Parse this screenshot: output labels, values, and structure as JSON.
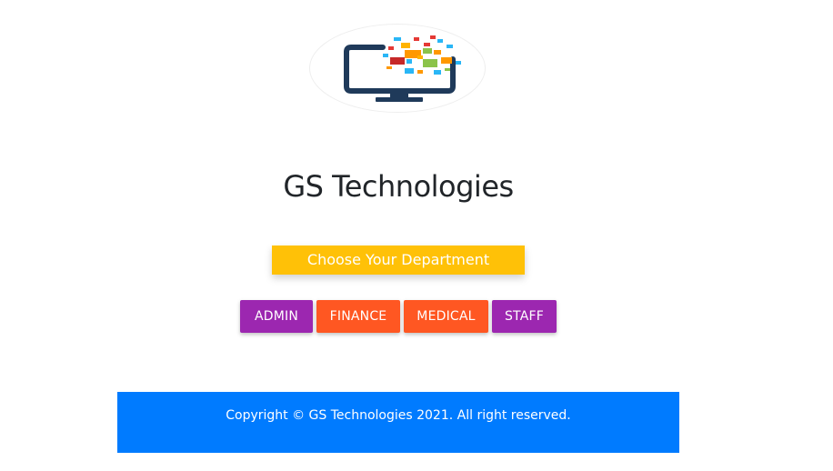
{
  "brand": {
    "logo_icon": "monitor-with-colorful-pixels-icon",
    "title": "GS Technologies"
  },
  "department": {
    "header": "Choose Your Department",
    "buttons": [
      {
        "label": "ADMIN",
        "color": "#9c27b0"
      },
      {
        "label": "FINANCE",
        "color": "#ff5722"
      },
      {
        "label": "MEDICAL",
        "color": "#ff5722"
      },
      {
        "label": "STAFF",
        "color": "#9c27b0"
      }
    ],
    "header_color": "#ffc107"
  },
  "footer": {
    "copyright": "Copyright © GS Technologies 2021. All right reserved.",
    "color": "#007bff"
  }
}
